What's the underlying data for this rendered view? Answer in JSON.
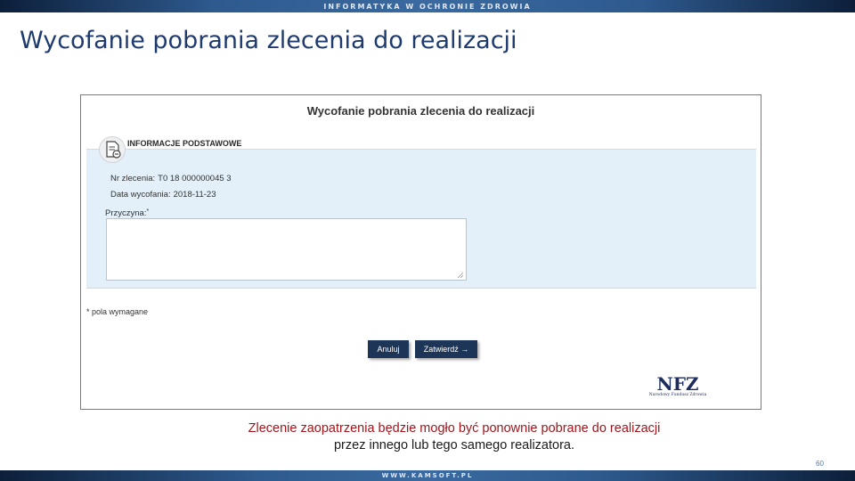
{
  "header_banner": "INFORMATYKA W OCHRONIE ZDROWIA",
  "slide_title": "Wycofanie pobrania zlecenia do realizacji",
  "dialog": {
    "title": "Wycofanie pobrania zlecenia do realizacji",
    "section_label": "INFORMACJE PODSTAWOWE",
    "order_number": {
      "label": "Nr zlecenia:",
      "value": "T0 18 000000045 3"
    },
    "withdrawal_date": {
      "label": "Data wycofania:",
      "value": "2018-11-23"
    },
    "reason": {
      "label": "Przyczyna:",
      "required_mark": "*",
      "value": ""
    },
    "required_note": "* pola wymagane",
    "cancel_label": "Anuluj",
    "confirm_label": "Zatwierdź →",
    "logo": {
      "letters": "NFZ",
      "subtitle": "Narodowy Fundusz Zdrowia"
    }
  },
  "caption": {
    "line1": "Zlecenie zaopatrzenia będzie mogło być ponownie pobrane do realizacji",
    "line2": "przez innego lub tego samego realizatora."
  },
  "page_number": "60",
  "footer_banner": "WWW.KAMSOFT.PL",
  "colors": {
    "title_blue": "#1f3b6e",
    "panel_bg": "#e3f0f9",
    "button_navy": "#1d3557",
    "caption_red": "#a0161c"
  }
}
